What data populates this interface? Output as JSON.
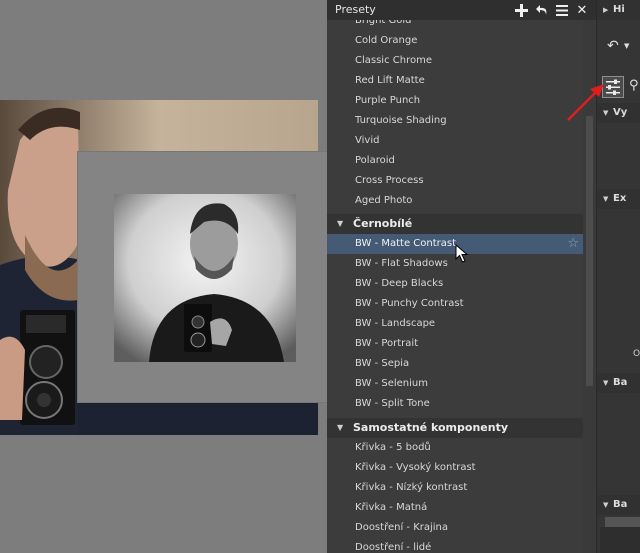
{
  "presets": {
    "title": "Presety",
    "items_top": [
      "Bright Gold",
      "Cold Orange",
      "Classic Chrome",
      "Red Lift Matte",
      "Purple Punch",
      "Turquoise Shading",
      "Vivid",
      "Polaroid",
      "Cross Process",
      "Aged Photo"
    ],
    "group_bw": "Černobílé",
    "items_bw": [
      "BW - Matte Contrast",
      "BW - Flat Shadows",
      "BW - Deep Blacks",
      "BW - Punchy Contrast",
      "BW - Landscape",
      "BW - Portrait",
      "BW - Sepia",
      "BW - Selenium",
      "BW - Split Tone"
    ],
    "group_components": "Samostatné komponenty",
    "items_components": [
      "Křivka - 5 bodů",
      "Křivka - Vysoký kontrast",
      "Křivka - Nízký kontrast",
      "Křivka - Matná",
      "Doostření - Krajina",
      "Doostření - lidé"
    ],
    "selected": "BW - Matte Contrast"
  },
  "right_panel": {
    "sections": [
      "Hi",
      "Vy",
      "Ex",
      "Ba",
      "Ba"
    ],
    "o_label": "O"
  },
  "colors": {
    "selected_row": "#455a75",
    "annotation_arrow": "#e01e1e"
  }
}
